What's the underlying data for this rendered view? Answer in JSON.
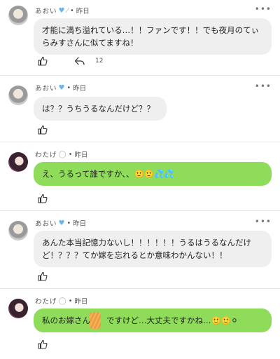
{
  "posts": [
    {
      "user": "あおい",
      "badges": [
        "heart-icon",
        "feather-icon"
      ],
      "date": "昨日",
      "text": "才能に満ち溢れている…！！ファンです！！でも夜月のてぃらみすさんに似てますね！",
      "reply_count": "12",
      "bubble_color": "#efefef"
    },
    {
      "user": "あおい",
      "badges": [
        "heart-icon"
      ],
      "date": "昨日",
      "text": "は？？うちうるなんだけど？？",
      "bubble_color": "#efefef"
    },
    {
      "user": "わたげ",
      "badges": [
        "circle-icon"
      ],
      "date": "昨日",
      "text": "え、うるって誰ですか、、🙂🙂💦💦",
      "bubble_color": "#8fdc5a"
    },
    {
      "user": "あおい",
      "badges": [
        "heart-icon"
      ],
      "date": "昨日",
      "text": "あんた本当記憶力ないし！！！！！！うるはうるなんだけど！？？？てか嫁を忘れるとか意味わかんない！！",
      "bubble_color": "#efefef"
    },
    {
      "user": "わたげ",
      "badges": [
        "circle-icon"
      ],
      "date": "昨日",
      "text": "私のお嫁さん　　ですけど…大丈夫ですかね…🙂🙂⚪",
      "bubble_color": "#8fdc5a"
    }
  ],
  "more_label": "•••"
}
